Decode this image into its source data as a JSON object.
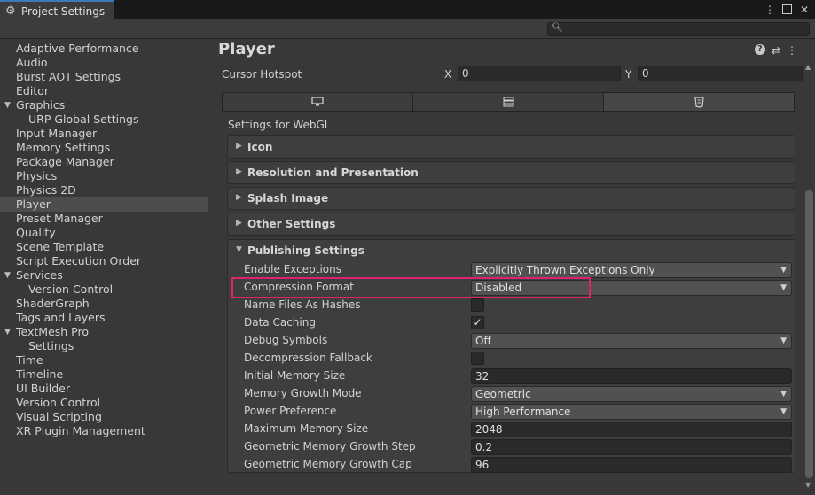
{
  "window": {
    "tab_title": "Project Settings",
    "menu_icon": "kebab-menu-icon",
    "maximize_icon": "maximize-icon",
    "close_icon": "close-icon"
  },
  "search": {
    "placeholder": ""
  },
  "sidebar": {
    "items": [
      {
        "label": "Adaptive Performance"
      },
      {
        "label": "Audio"
      },
      {
        "label": "Burst AOT Settings"
      },
      {
        "label": "Editor"
      },
      {
        "label": "Graphics"
      },
      {
        "label": "URP Global Settings"
      },
      {
        "label": "Input Manager"
      },
      {
        "label": "Memory Settings"
      },
      {
        "label": "Package Manager"
      },
      {
        "label": "Physics"
      },
      {
        "label": "Physics 2D"
      },
      {
        "label": "Player"
      },
      {
        "label": "Preset Manager"
      },
      {
        "label": "Quality"
      },
      {
        "label": "Scene Template"
      },
      {
        "label": "Script Execution Order"
      },
      {
        "label": "Services"
      },
      {
        "label": "Version Control"
      },
      {
        "label": "ShaderGraph"
      },
      {
        "label": "Tags and Layers"
      },
      {
        "label": "TextMesh Pro"
      },
      {
        "label": "Settings"
      },
      {
        "label": "Time"
      },
      {
        "label": "Timeline"
      },
      {
        "label": "UI Builder"
      },
      {
        "label": "Version Control"
      },
      {
        "label": "Visual Scripting"
      },
      {
        "label": "XR Plugin Management"
      }
    ],
    "selected": "Player"
  },
  "main": {
    "title": "Player",
    "cursor_hotspot": {
      "label": "Cursor Hotspot",
      "x_label": "X",
      "x_value": "0",
      "y_label": "Y",
      "y_value": "0"
    },
    "platform_tabs": [
      {
        "icon": "desktop-icon"
      },
      {
        "icon": "server-icon"
      },
      {
        "icon": "webgl-html5-icon"
      }
    ],
    "settings_for": "Settings for WebGL",
    "sections": {
      "icon": "Icon",
      "resolution": "Resolution and Presentation",
      "splash": "Splash Image",
      "other": "Other Settings",
      "publishing": "Publishing Settings"
    },
    "publishing": {
      "enable_exceptions": {
        "label": "Enable Exceptions",
        "value": "Explicitly Thrown Exceptions Only"
      },
      "compression_format": {
        "label": "Compression Format",
        "value": "Disabled"
      },
      "name_files_as_hashes": {
        "label": "Name Files As Hashes",
        "checked": false
      },
      "data_caching": {
        "label": "Data Caching",
        "checked": true,
        "check_glyph": "✓"
      },
      "debug_symbols": {
        "label": "Debug Symbols",
        "value": "Off"
      },
      "decompression_fallback": {
        "label": "Decompression Fallback",
        "checked": false
      },
      "initial_memory_size": {
        "label": "Initial Memory Size",
        "value": "32"
      },
      "memory_growth_mode": {
        "label": "Memory Growth Mode",
        "value": "Geometric"
      },
      "power_preference": {
        "label": "Power Preference",
        "value": "High Performance"
      },
      "maximum_memory_size": {
        "label": "Maximum Memory Size",
        "value": "2048"
      },
      "geometric_step": {
        "label": "Geometric Memory Growth Step",
        "value": "0.2"
      },
      "geometric_cap": {
        "label": "Geometric Memory Growth Cap",
        "value": "96"
      }
    }
  },
  "colors": {
    "highlight": "#e0216b",
    "selected_row": "#4d4d4d",
    "background": "#383838"
  }
}
